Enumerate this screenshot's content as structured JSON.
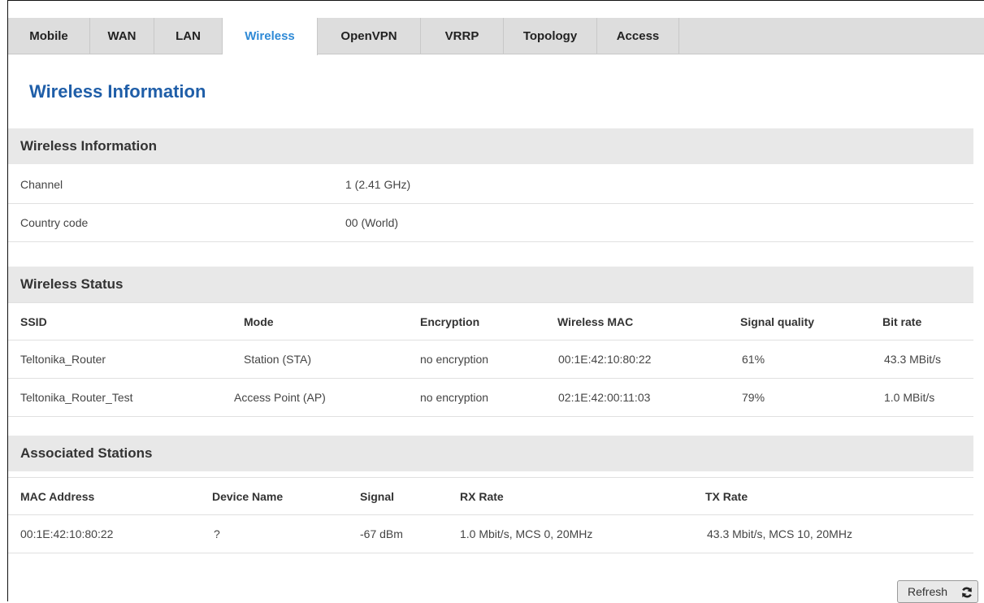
{
  "tabs": [
    "Mobile",
    "WAN",
    "LAN",
    "Wireless",
    "OpenVPN",
    "VRRP",
    "Topology",
    "Access"
  ],
  "page_title": "Wireless Information",
  "info": {
    "title": "Wireless Information",
    "rows": [
      {
        "label": "Channel",
        "value": "1 (2.41 GHz)"
      },
      {
        "label": "Country code",
        "value": "00 (World)"
      }
    ]
  },
  "status": {
    "title": "Wireless Status",
    "headers": [
      "SSID",
      "Mode",
      "Encryption",
      "Wireless MAC",
      "Signal quality",
      "Bit rate"
    ],
    "rows": [
      [
        "Teltonika_Router",
        "Station (STA)",
        "no encryption",
        "00:1E:42:10:80:22",
        "61%",
        "43.3 MBit/s"
      ],
      [
        "Teltonika_Router_Test",
        "Access Point (AP)",
        "no encryption",
        "02:1E:42:00:11:03",
        "79%",
        "1.0 MBit/s"
      ]
    ]
  },
  "stations": {
    "title": "Associated Stations",
    "headers": [
      "MAC Address",
      "Device Name",
      "Signal",
      "RX Rate",
      "TX Rate"
    ],
    "rows": [
      [
        "00:1E:42:10:80:22",
        "?",
        "-67 dBm",
        "1.0 Mbit/s, MCS 0, 20MHz",
        "43.3 Mbit/s, MCS 10, 20MHz"
      ]
    ]
  },
  "refresh_label": "Refresh",
  "refresh_icon": "refresh-icon",
  "colors": {
    "accent": "#2f8ad6",
    "title": "#1f5ea8",
    "tabbar": "#dddddd"
  }
}
